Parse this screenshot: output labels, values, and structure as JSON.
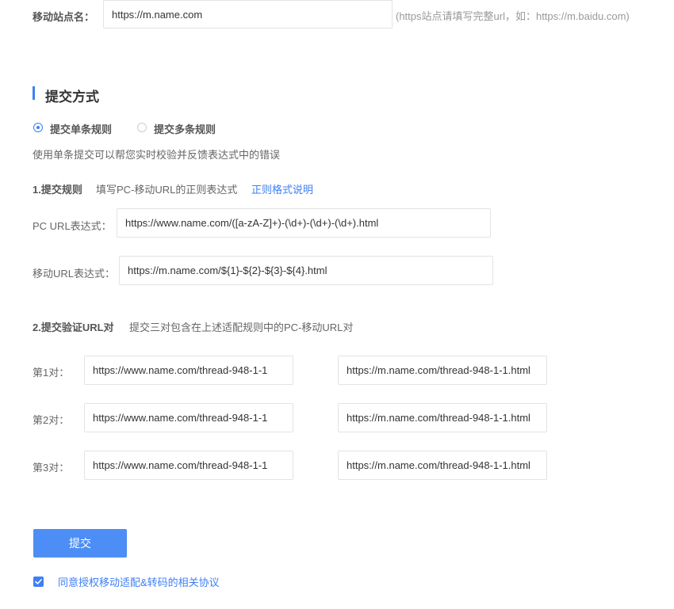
{
  "mobile_site": {
    "label": "移动站点名：",
    "value": "https://m.name.com",
    "hint": "(https站点请填写完整url，如：https://m.baidu.com)"
  },
  "submit_method": {
    "title": "提交方式",
    "options": [
      {
        "label": "提交单条规则",
        "selected": true
      },
      {
        "label": "提交多条规则",
        "selected": false
      }
    ],
    "description": "使用单条提交可以帮您实时校验并反馈表达式中的错误"
  },
  "rules": {
    "heading": "1.提交规则",
    "subheading": "填写PC-移动URL的正则表达式",
    "help_link": "正则格式说明",
    "pc_label": "PC  URL表达式：",
    "pc_value": "https://www.name.com/([a-zA-Z]+)-(\\d+)-(\\d+)-(\\d+).html",
    "mobile_label": "移动URL表达式：",
    "mobile_value": "https://m.name.com/${1}-${2}-${3}-${4}.html"
  },
  "verify": {
    "heading": "2.提交验证URL对",
    "subheading": "提交三对包含在上述适配规则中的PC-移动URL对",
    "pairs": [
      {
        "label": "第1对：",
        "pc": "https://www.name.com/thread-948-1-1",
        "mobile": "https://m.name.com/thread-948-1-1.html"
      },
      {
        "label": "第2对：",
        "pc": "https://www.name.com/thread-948-1-1",
        "mobile": "https://m.name.com/thread-948-1-1.html"
      },
      {
        "label": "第3对：",
        "pc": "https://www.name.com/thread-948-1-1",
        "mobile": "https://m.name.com/thread-948-1-1.html"
      }
    ]
  },
  "actions": {
    "submit_label": "提交",
    "agreement_text": "同意授权移动适配&转码的相关协议",
    "agreement_checked": true
  },
  "colors": {
    "accent": "#3d7ff4",
    "button": "#4d8ef6"
  }
}
